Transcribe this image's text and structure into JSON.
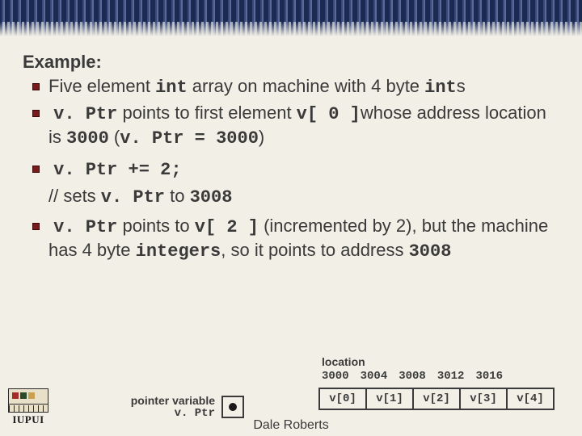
{
  "heading": "Example:",
  "bullets": {
    "b1_pre": "Five element ",
    "b1_code1": "int",
    "b1_mid": " array on machine with 4 byte ",
    "b1_code2": "int",
    "b1_suf": "s",
    "b2_code1": "v. Ptr",
    "b2_mid1": " points to first element ",
    "b2_code2": "v[ 0 ]",
    "b2_mid2": "whose address location is ",
    "b2_code3": "3000",
    "b2_mid3": " (",
    "b2_code4": "v. Ptr = 3000",
    "b2_suf": ")",
    "b3_code": "v. Ptr += 2;",
    "comment_pre": "// sets ",
    "comment_c1": "v. Ptr",
    "comment_mid": " to ",
    "comment_c2": "3008",
    "b4_code1": "v. Ptr",
    "b4_mid1": " points to ",
    "b4_code2": "v[ 2 ]",
    "b4_mid2": " (incremented by 2), but the machine has 4 byte ",
    "b4_code3": "integers",
    "b4_mid3": ", so it points to address ",
    "b4_code4": "3008"
  },
  "diagram": {
    "location_label": "location",
    "addresses": [
      "3000",
      "3004",
      "3008",
      "3012",
      "3016"
    ],
    "cells": [
      "v[0]",
      "v[1]",
      "v[2]",
      "v[3]",
      "v[4]"
    ]
  },
  "pointer": {
    "label_l1": "pointer variable",
    "label_l2": "v. Ptr"
  },
  "footer": "Dale Roberts",
  "logo_text": "IUPUI"
}
